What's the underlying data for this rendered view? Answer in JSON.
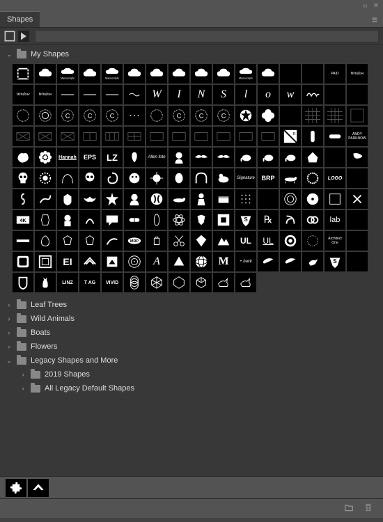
{
  "panel": {
    "title": "Shapes"
  },
  "folders": {
    "expanded_main": "My Shapes",
    "collapsed": [
      "Leaf Trees",
      "Wild Animals",
      "Boats",
      "Flowers"
    ],
    "legacy": {
      "label": "Legacy Shapes and More",
      "children": [
        "2019 Shapes",
        "All Legacy Default Shapes"
      ]
    }
  },
  "shape_labels": {
    "4k": "4K",
    "eps": "EPS",
    "lz": "LZ",
    "ei": "EI",
    "m": "M",
    "ul1": "UL",
    "ul2": "UL",
    "linz": "LINZ",
    "tag": "T AG",
    "vivid": "VIVID",
    "brp": "BRP",
    "rx": "℞",
    "lab": "lab",
    "w": "W",
    "s": "S",
    "i": "I",
    "n": "N",
    "l": "l",
    "o": "o",
    "ww": "w",
    "hb": "+ back",
    "logo": "LOGO",
    "ap": "ANDY\nPARKNOW",
    "mrp": "MRP",
    "af": "Allen foto",
    "manu": "Manuscripts",
    "window": "Window",
    "paid": "PAID"
  }
}
